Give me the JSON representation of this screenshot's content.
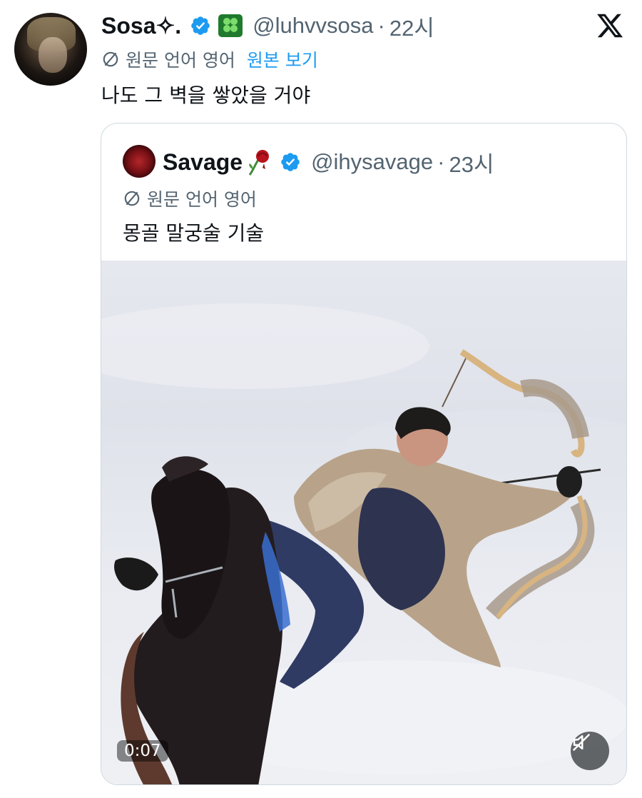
{
  "tweet": {
    "display_name": "Sosa✧.",
    "handle": "@luhvvsosa",
    "time": "22시",
    "translation_label": "원문 언어 영어",
    "show_original": "원본 보기",
    "text": "나도 그 벽을 쌓았을 거야",
    "avatar_icon": "profile-photo",
    "badge_icon": "four-leaf-clover-emoji"
  },
  "quote": {
    "display_name": "Savage",
    "handle": "@ihysavage",
    "time": "23시",
    "translation_label": "원문 언어 영어",
    "text": "몽골 말궁술 기술",
    "badge_icon": "wilted-rose-emoji",
    "media": {
      "type": "video",
      "duration": "0:07",
      "muted": true
    }
  },
  "meta_separator": "·",
  "colors": {
    "verified_blue": "#1d9bf0",
    "link_blue": "#1d9bf0",
    "secondary_text": "#536471",
    "primary_text": "#0f1419",
    "border": "#cfd9de"
  }
}
